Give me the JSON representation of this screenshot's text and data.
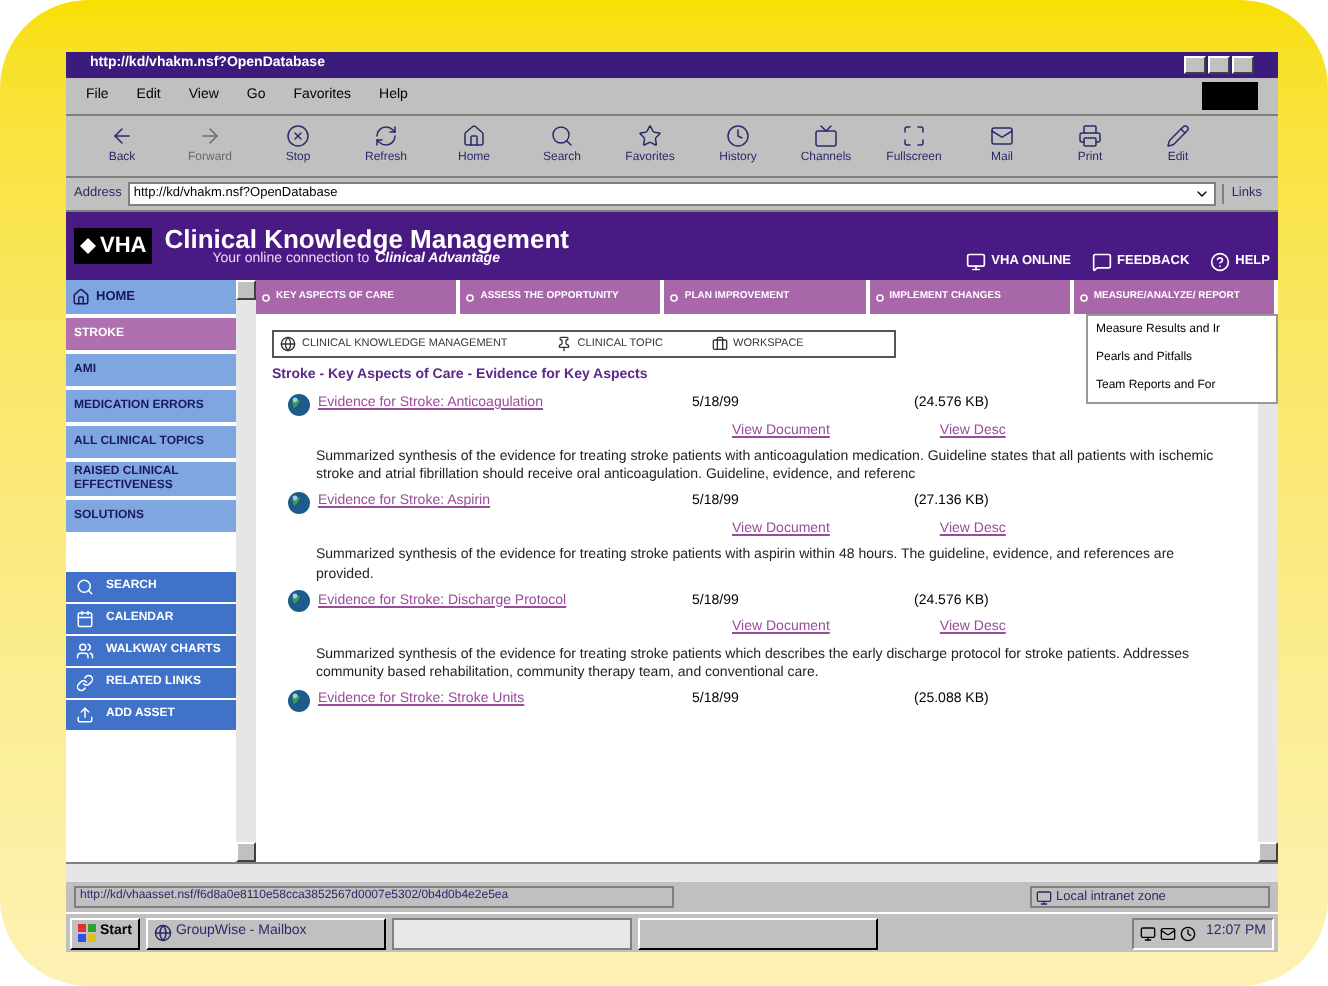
{
  "window": {
    "title": "http://kd/vhakm.nsf?OpenDatabase"
  },
  "menu": [
    "File",
    "Edit",
    "View",
    "Go",
    "Favorites",
    "Help"
  ],
  "toolbar": [
    {
      "label": "Back",
      "disabled": false
    },
    {
      "label": "Forward",
      "disabled": true
    },
    {
      "label": "Stop",
      "disabled": false
    },
    {
      "label": "Refresh",
      "disabled": false
    },
    {
      "label": "Home",
      "disabled": false
    },
    {
      "label": "Search",
      "disabled": false
    },
    {
      "label": "Favorites",
      "disabled": false
    },
    {
      "label": "History",
      "disabled": false
    },
    {
      "label": "Channels",
      "disabled": false
    },
    {
      "label": "Fullscreen",
      "disabled": false
    },
    {
      "label": "Mail",
      "disabled": false
    },
    {
      "label": "Print",
      "disabled": false
    },
    {
      "label": "Edit",
      "disabled": false
    }
  ],
  "address": {
    "label": "Address",
    "value": "http://kd/vhakm.nsf?OpenDatabase",
    "links": "Links"
  },
  "header": {
    "logo": "VHA",
    "title": "Clinical Knowledge Management",
    "subtitle": "Your online connection to",
    "subtitle_emphasis": "Clinical Advantage",
    "buttons": [
      "VHA ONLINE",
      "FEEDBACK",
      "HELP"
    ]
  },
  "nav_tabs": [
    "KEY ASPECTS OF CARE",
    "ASSESS THE OPPORTUNITY",
    "PLAN IMPROVEMENT",
    "IMPLEMENT CHANGES",
    "MEASURE/ANALYZE/ REPORT"
  ],
  "dropdown": [
    "Measure Results and Ir",
    "Pearls and Pitfalls",
    "Team Reports and For"
  ],
  "sidebar": [
    {
      "kind": "home",
      "label": "HOME",
      "selected": false
    },
    {
      "kind": "topic",
      "label": "STROKE",
      "selected": true
    },
    {
      "kind": "topic",
      "label": "AMI",
      "selected": false
    },
    {
      "kind": "topic",
      "label": "MEDICATION ERRORS",
      "selected": false
    },
    {
      "kind": "topic",
      "label": "ALL CLINICAL TOPICS",
      "selected": false
    },
    {
      "kind": "topic",
      "label": "RAISED CLINICAL EFFECTIVENESS",
      "selected": false
    },
    {
      "kind": "topic",
      "label": "SOLUTIONS",
      "selected": false
    },
    {
      "kind": "tool",
      "label": "SEARCH",
      "selected": false
    },
    {
      "kind": "tool",
      "label": "CALENDAR",
      "selected": false
    },
    {
      "kind": "tool",
      "label": "WALKWAY CHARTS",
      "selected": false
    },
    {
      "kind": "tool",
      "label": "RELATED LINKS",
      "selected": false
    },
    {
      "kind": "tool",
      "label": "ADD ASSET",
      "selected": false
    }
  ],
  "breadcrumb": [
    "CLINICAL KNOWLEDGE MANAGEMENT",
    "CLINICAL TOPIC",
    "WORKSPACE"
  ],
  "heading": "Stroke - Key Aspects of Care - Evidence for Key Aspects",
  "documents": [
    {
      "title": "Evidence for Stroke: Anticoagulation",
      "date": "5/18/99",
      "size": "(24.576 KB)",
      "view_document": "View Document",
      "view_desc": "View Desc",
      "description": "Summarized synthesis of the evidence for treating stroke patients with anticoagulation medication. Guideline states that all patients with ischemic stroke and atrial fibrillation should receive oral anticoagulation. Guideline, evidence, and referenc"
    },
    {
      "title": "Evidence for Stroke: Aspirin",
      "date": "5/18/99",
      "size": "(27.136 KB)",
      "view_document": "View Document",
      "view_desc": "View Desc",
      "description": "Summarized synthesis of the evidence for treating stroke patients with aspirin within 48 hours. The guideline, evidence, and references are provided."
    },
    {
      "title": "Evidence for Stroke: Discharge Protocol",
      "date": "5/18/99",
      "size": "(24.576 KB)",
      "view_document": "View Document",
      "view_desc": "View Desc",
      "description": "Summarized synthesis of the evidence for treating stroke patients which describes the early discharge protocol for stroke patients. Addresses community based rehabilitation, community therapy team, and conventional care."
    },
    {
      "title": "Evidence for Stroke: Stroke Units",
      "date": "5/18/99",
      "size": "(25.088 KB)"
    }
  ],
  "status_bar": {
    "url": "http://kd/vhaasset.nsf/f6d8a0e8110e58cca3852567d0007e5302/0b4d0b4e2e5ea",
    "zone": "Local intranet zone"
  },
  "taskbar": {
    "start": "Start",
    "tasks": [
      "GroupWise - Mailbox"
    ],
    "clock": "12:07 PM"
  }
}
